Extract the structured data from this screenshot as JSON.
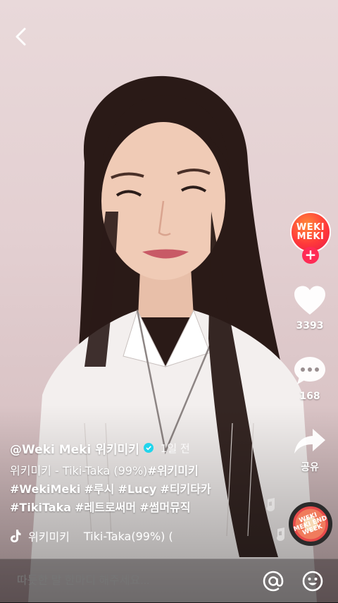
{
  "author": {
    "handle": "@Weki Meki 위키미키",
    "time_ago": "1일 전",
    "avatar_logo_top": "WEKI",
    "avatar_logo_bottom": "MEKI"
  },
  "caption": {
    "line1": "위키미키 - Tiki-Taka (99%)",
    "line1_tag": "#위키미키",
    "line2_tags": [
      "#WekiMeki",
      "#루시",
      "#Lucy",
      "#티키타카"
    ],
    "line3_tags": [
      "#TikiTaka",
      "#레트로써머",
      "#썸머뮤직"
    ]
  },
  "music": {
    "artist": "위키미키",
    "track": "Tiki-Taka(99%) ("
  },
  "actions": {
    "likes": "3393",
    "comments": "168",
    "share_label": "공유"
  },
  "comment_bar": {
    "placeholder": "따듯한 말 한마디 해주세요..."
  },
  "disc": {
    "text": "WEKI MEKI END WEEK"
  },
  "colors": {
    "follow_plus": "#ff2b55",
    "verified": "#20d5ec",
    "avatar_accent": "#ff3a3a"
  },
  "icons": [
    "back-icon",
    "heart-icon",
    "comment-icon",
    "share-icon",
    "tiktok-note-icon",
    "at-icon",
    "emoji-icon",
    "music-notes-icon",
    "verified-icon"
  ]
}
